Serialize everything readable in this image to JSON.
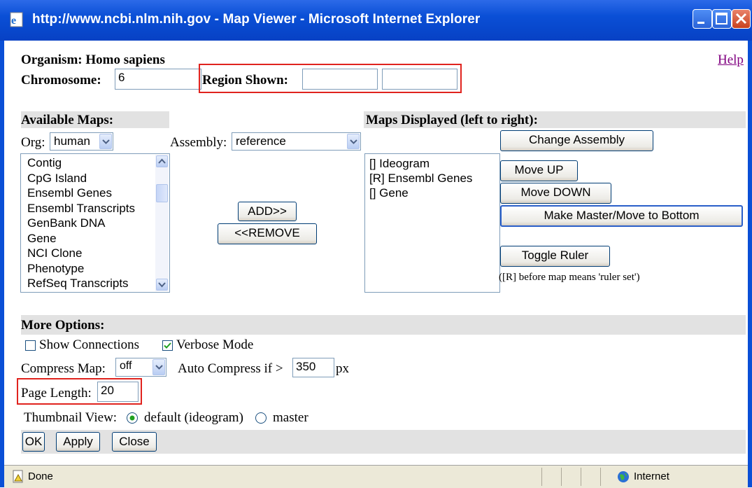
{
  "window": {
    "title": "http://www.ncbi.nlm.nih.gov - Map Viewer - Microsoft Internet Explorer"
  },
  "header": {
    "organism_label": "Organism: Homo sapiens",
    "help_link": "Help",
    "chromosome_label": "Chromosome:",
    "chromosome_value": "6",
    "region_label": "Region Shown:",
    "region_start": "",
    "region_end": ""
  },
  "available_maps": {
    "section_title": "Available Maps:",
    "org_label": "Org:",
    "org_value": "human",
    "assembly_label": "Assembly:",
    "assembly_value": "reference",
    "items": [
      "Contig",
      "CpG Island",
      "Ensembl Genes",
      "Ensembl Transcripts",
      "GenBank DNA",
      "Gene",
      "NCI Clone",
      "Phenotype",
      "RefSeq Transcripts"
    ],
    "add_label": "ADD>>",
    "remove_label": "<<REMOVE"
  },
  "maps_displayed": {
    "section_title": "Maps Displayed (left to right):",
    "items": [
      "[] Ideogram",
      "[R] Ensembl Genes",
      "[] Gene"
    ],
    "change_assembly_label": "Change Assembly",
    "move_up_label": "Move UP",
    "move_down_label": "Move DOWN",
    "make_master_label": "Make Master/Move to Bottom",
    "toggle_ruler_label": "Toggle Ruler",
    "ruler_note": "([R] before map means 'ruler set')"
  },
  "more_options": {
    "section_title": "More Options:",
    "show_connections_label": "Show Connections",
    "show_connections_checked": false,
    "verbose_mode_label": "Verbose Mode",
    "verbose_mode_checked": true,
    "compress_map_label": "Compress Map:",
    "compress_map_value": "off",
    "auto_compress_label": "Auto Compress if >",
    "auto_compress_value": "350",
    "auto_compress_unit": "px",
    "page_length_label": "Page Length:",
    "page_length_value": "20",
    "thumbnail_label": "Thumbnail View:",
    "thumbnail_default_label": "default (ideogram)",
    "thumbnail_master_label": "master",
    "thumbnail_selected": "default"
  },
  "actions": {
    "ok_label": "OK",
    "apply_label": "Apply",
    "close_label": "Close"
  },
  "status": {
    "left_text": "Done",
    "zone_text": "Internet"
  },
  "colors": {
    "titlebar": "#0a4fd6",
    "highlight_box": "#e0231e",
    "link": "#800080"
  }
}
